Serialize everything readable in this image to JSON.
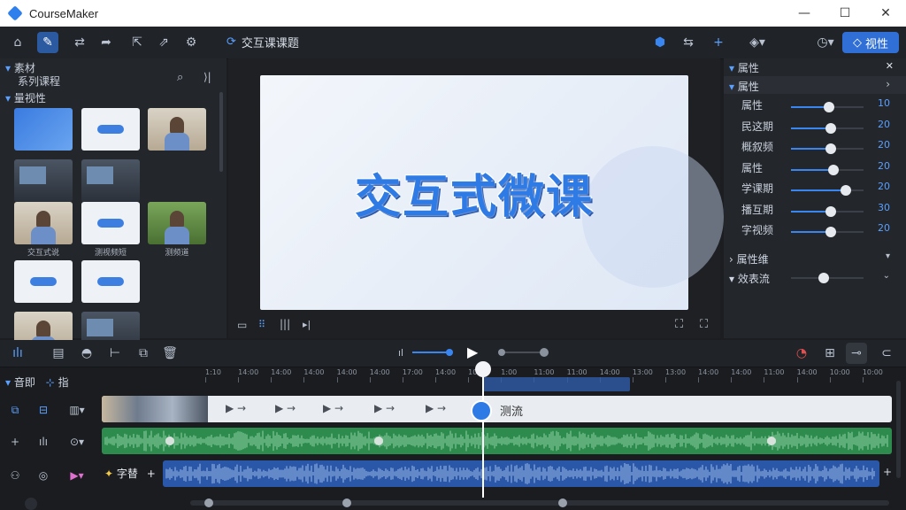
{
  "app": {
    "title": "CourseMaker"
  },
  "window_controls": {
    "minimize": "—",
    "maximize": "☐",
    "close": "✕"
  },
  "toolbar": {
    "project_title": "交互课课题",
    "preview_label": "视性"
  },
  "left_panel": {
    "section1_title": "素材",
    "section1_sub": "系列课程",
    "section2_title": "量视性",
    "thumbnails": [
      {
        "style": "blue",
        "label": ""
      },
      {
        "style": "light",
        "label": ""
      },
      {
        "style": "photo",
        "label": ""
      },
      {
        "style": "dark",
        "label": ""
      },
      {
        "style": "dark",
        "label": ""
      },
      {
        "style": "photo",
        "label": "交互式说"
      },
      {
        "style": "light",
        "label": "测视频短"
      },
      {
        "style": "green",
        "label": "测频道"
      },
      {
        "style": "light",
        "label": ""
      },
      {
        "style": "light",
        "label": ""
      },
      {
        "style": "photo",
        "label": ""
      },
      {
        "style": "dark",
        "label": ""
      }
    ]
  },
  "canvas": {
    "title": "交互式微课"
  },
  "right_panel": {
    "header": "属性",
    "section": "属性",
    "properties": [
      {
        "label": "属性",
        "value": "10",
        "level": 0.52
      },
      {
        "label": "民这期",
        "value": "20",
        "level": 0.55
      },
      {
        "label": "概叙频",
        "value": "20",
        "level": 0.55
      },
      {
        "label": "属性",
        "value": "20",
        "level": 0.58
      },
      {
        "label": "学课期",
        "value": "20",
        "level": 0.75
      },
      {
        "label": "播互期",
        "value": "30",
        "level": 0.55
      },
      {
        "label": "字视频",
        "value": "20",
        "level": 0.55
      }
    ],
    "section2": "属性维",
    "section3": "效表流"
  },
  "timeline": {
    "header_label": "音即",
    "header_label2": "指",
    "ruler_ticks": [
      "1:10",
      "14:00",
      "14:00",
      "14:00",
      "14:00",
      "14:00",
      "17:00",
      "14:00",
      "10:00",
      "1:00",
      "11:00",
      "11:00",
      "14:00",
      "13:00",
      "13:00",
      "14:00",
      "14:00",
      "11:00",
      "14:00",
      "10:00",
      "10:00"
    ],
    "video_track_label": "测流",
    "text_track_label": "字替",
    "add_symbol": "+",
    "clip_play_symbol": "▶ →"
  }
}
